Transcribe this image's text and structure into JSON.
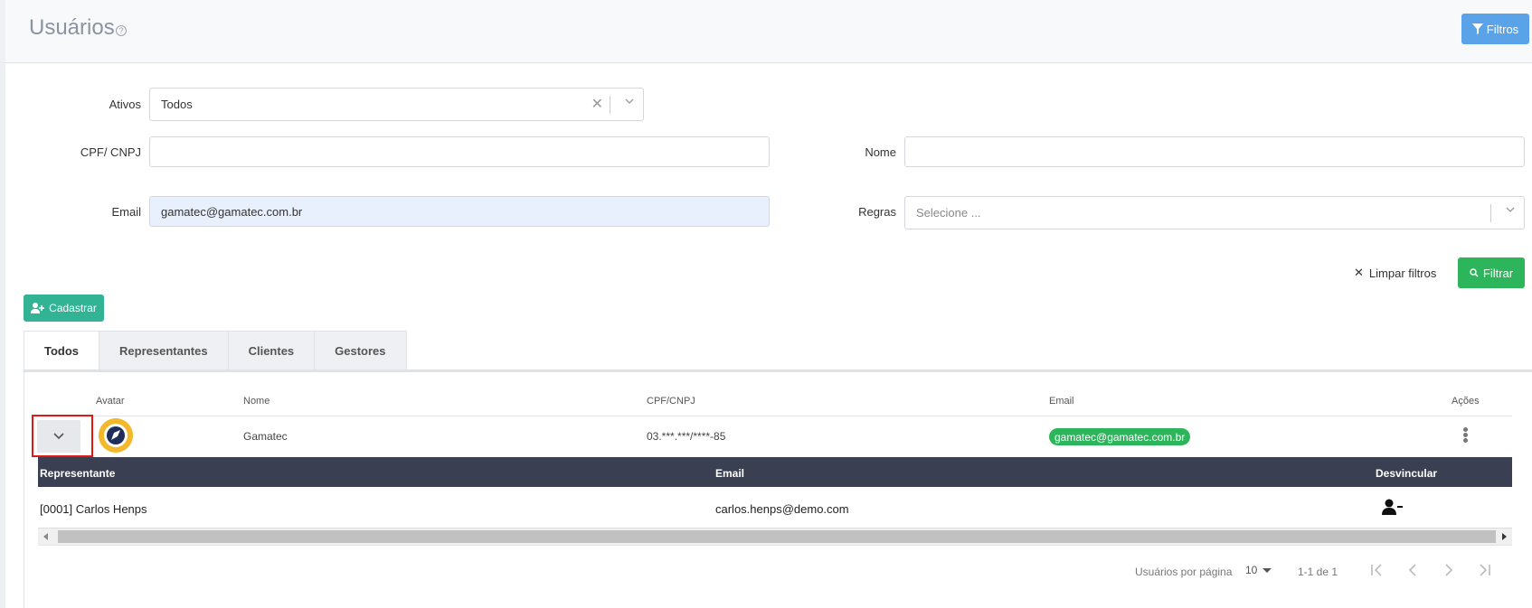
{
  "header": {
    "title": "Usuários",
    "filters_button": "Filtros"
  },
  "filters": {
    "ativos": {
      "label": "Ativos",
      "value": "Todos"
    },
    "cpf": {
      "label": "CPF/ CNPJ",
      "value": ""
    },
    "nome": {
      "label": "Nome",
      "value": ""
    },
    "email": {
      "label": "Email",
      "value": "gamatec@gamatec.com.br"
    },
    "regras": {
      "label": "Regras",
      "placeholder": "Selecione ..."
    },
    "clear_label": "Limpar filtros",
    "submit_label": "Filtrar"
  },
  "actions": {
    "cadastrar_label": "Cadastrar"
  },
  "tabs": [
    {
      "label": "Todos",
      "active": true
    },
    {
      "label": "Representantes",
      "active": false
    },
    {
      "label": "Clientes",
      "active": false
    },
    {
      "label": "Gestores",
      "active": false
    }
  ],
  "table": {
    "columns": [
      "Avatar",
      "Nome",
      "CPF/CNPJ",
      "Email",
      "Ações"
    ],
    "rows": [
      {
        "nome": "Gamatec",
        "cpf": "03.***.***/****-85",
        "email": "gamatec@gamatec.com.br"
      }
    ],
    "subtable": {
      "columns": [
        "Representante",
        "Email",
        "Desvincular"
      ],
      "rows": [
        {
          "representante": "[0001] Carlos Henps",
          "email": "carlos.henps@demo.com"
        }
      ]
    }
  },
  "pagination": {
    "per_page_label": "Usuários por página",
    "per_page_value": "10",
    "range": "1-1 de 1"
  },
  "colors": {
    "primary": "#5aa3e8",
    "success": "#2cb55a",
    "teal": "#32b394",
    "dark_header": "#3a3f51",
    "highlight_border": "#e01818"
  }
}
